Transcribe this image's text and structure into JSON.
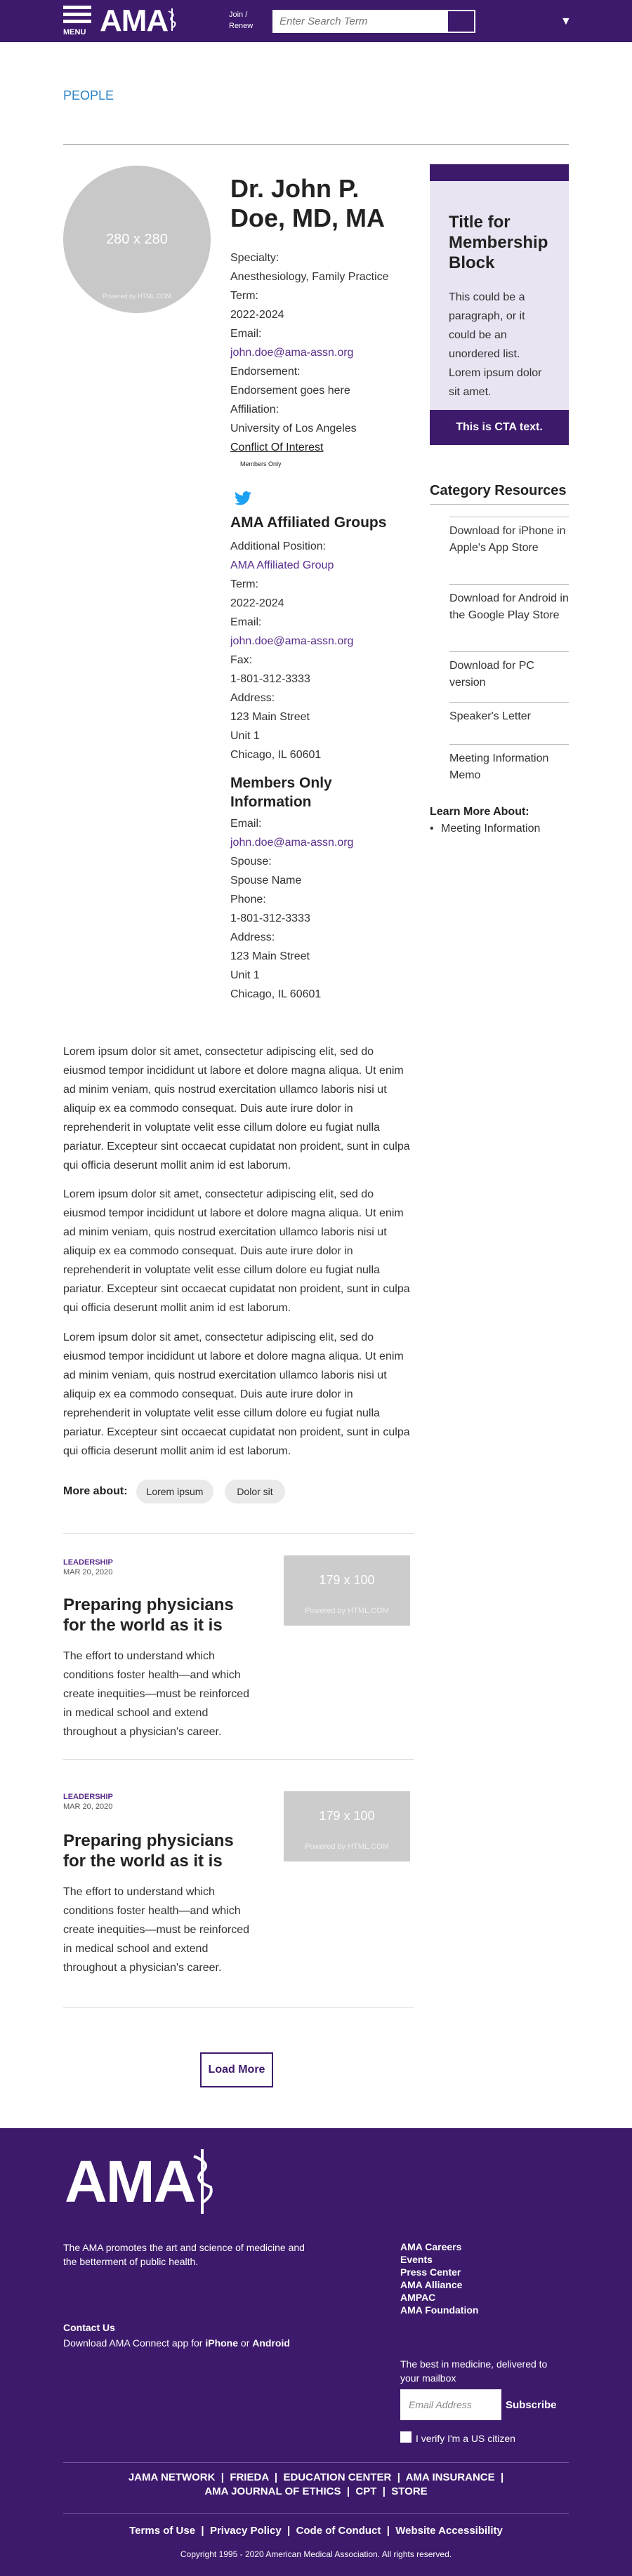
{
  "header": {
    "menu_label": "MENU",
    "logo": "AMA",
    "join_line1": "Join /",
    "join_line2": "Renew",
    "search_placeholder": "Enter Search Term",
    "brand_color": "#3d1a6b"
  },
  "breadcrumb": {
    "people": "PEOPLE"
  },
  "profile": {
    "avatar_text": "280 x 280",
    "avatar_powered": "Powered by HTML.COM",
    "name": "Dr. John P. Doe, MD, MA",
    "specialty_label": "Specialty:",
    "specialty": "Anesthesiology, Family Practice",
    "term_label": "Term:",
    "term": "2022-2024",
    "email_label": "Email:",
    "email": "john.doe@ama-assn.org",
    "endorsement_label": "Endorsement:",
    "endorsement": "Endorsement goes here",
    "affiliation_label": "Affiliation:",
    "affiliation": "University of Los Angeles",
    "conflict": "Conflict Of Interest",
    "members_only": "Members Only"
  },
  "affiliated": {
    "heading": "AMA Affiliated Groups",
    "position_label": "Additional Position:",
    "position": "AMA Affiliated Group",
    "term_label": "Term:",
    "term": "2022-2024",
    "email_label": "Email:",
    "email": "john.doe@ama-assn.org",
    "fax_label": "Fax:",
    "fax": "1-801-312-3333",
    "address_label": "Address:",
    "address1": "123 Main Street",
    "address2": "Unit 1",
    "address3": "Chicago, IL 60601"
  },
  "members_info": {
    "heading": "Members Only Information",
    "email_label": "Email:",
    "email": "john.doe@ama-assn.org",
    "spouse_label": "Spouse:",
    "spouse": "Spouse Name",
    "phone_label": "Phone:",
    "phone": "1-801-312-3333",
    "address_label": "Address:",
    "address1": "123 Main Street",
    "address2": "Unit 1",
    "address3": "Chicago, IL 60601"
  },
  "membership": {
    "title": "Title for Membership Block",
    "body": "This could be a paragraph, or it could be an unordered list. Lorem ipsum dolor sit amet.",
    "cta": "This is CTA text."
  },
  "resources": {
    "heading": "Category Resources",
    "items": [
      "Download for iPhone in Apple's App Store",
      "Download for Android in the Google Play Store",
      "Download for PC version",
      "Speaker's Letter",
      "Meeting Information Memo"
    ],
    "learn_heading": "Learn More About:",
    "learn_item": "Meeting Information"
  },
  "body": {
    "paragraph": "Lorem ipsum dolor sit amet, consectetur adipiscing elit, sed do eiusmod tempor incididunt ut labore et dolore magna aliqua. Ut enim ad minim veniam, quis nostrud exercitation ullamco laboris nisi ut aliquip ex ea commodo consequat. Duis aute irure dolor in reprehenderit in voluptate velit esse cillum dolore eu fugiat nulla pariatur. Excepteur sint occaecat cupidatat non proident, sunt in culpa qui officia deserunt mollit anim id est laborum.",
    "more_label": "More about:",
    "tag1": "Lorem ipsum",
    "tag2": "Dolor sit"
  },
  "cards": [
    {
      "category": "LEADERSHIP",
      "date": "MAR 20, 2020",
      "title": "Preparing physicians for the world as it is",
      "text": "The effort to understand which conditions foster health—and which create inequities—must be reinforced in medical school and extend throughout a physician's career.",
      "thumb": "179 x 100",
      "thumb_powered": "Powered by HTML.COM"
    },
    {
      "category": "LEADERSHIP",
      "date": "MAR 20, 2020",
      "title": "Preparing physicians for the world as it is",
      "text": "The effort to understand which conditions foster health—and which create inequities—must be reinforced in medical school and extend throughout a physician's career.",
      "thumb": "179 x 100",
      "thumb_powered": "Powered by HTML.COM"
    }
  ],
  "load_more": "Load More",
  "footer": {
    "logo": "AMA",
    "description": "The AMA promotes the art and science of medicine and the betterment of public health.",
    "links": [
      "AMA Careers",
      "Events",
      "Press Center",
      "AMA Alliance",
      "AMPAC",
      "AMA Foundation"
    ],
    "contact": "Contact Us",
    "app_prefix": "Download AMA Connect app for ",
    "app_iphone": "iPhone",
    "app_or": " or ",
    "app_android": "Android",
    "best": "The best in medicine, delivered to your mailbox",
    "email_placeholder": "Email Address",
    "subscribe": "Subscribe",
    "verify": "I verify I'm a US citizen",
    "network_row1": [
      "JAMA NETWORK",
      "FRIEDA",
      "EDUCATION CENTER",
      "AMA INSURANCE"
    ],
    "network_row2": [
      "AMA JOURNAL OF ETHICS",
      "CPT",
      "STORE"
    ],
    "legal": [
      "Terms of Use",
      "Privacy Policy",
      "Code of Conduct",
      "Website Accessibility"
    ],
    "copyright": "Copyright 1995 - 2020 American Medical Association. All rights reserved."
  }
}
